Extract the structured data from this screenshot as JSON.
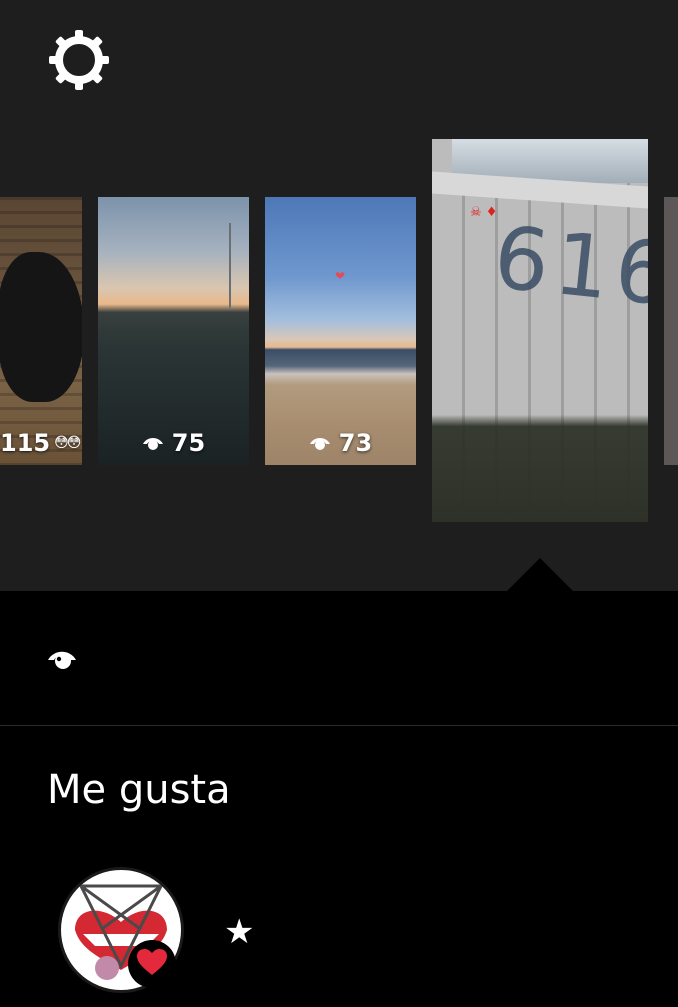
{
  "header": {
    "settings_icon": "gear-icon"
  },
  "stories": [
    {
      "views": "115",
      "emoji": "😳😳"
    },
    {
      "views": "75"
    },
    {
      "views": "73"
    },
    {
      "selected": true
    },
    {}
  ],
  "likes": {
    "title": "Me gusta",
    "liker_badge_icon": "heart-icon",
    "star_glyph": "★"
  },
  "colors": {
    "top_background": "#1e1e1f",
    "bottom_background": "#000000",
    "heart": "#e5293c"
  }
}
